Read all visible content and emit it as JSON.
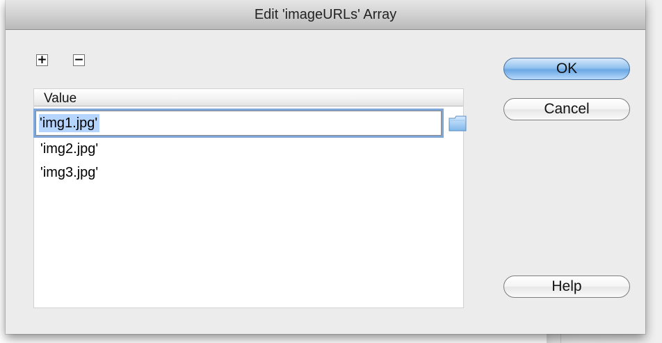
{
  "dialog": {
    "title": "Edit 'imageURLs' Array",
    "add_symbol": "+",
    "remove_symbol": "−"
  },
  "list": {
    "column_header": "Value",
    "items": [
      "'img1.jpg'",
      "'img2.jpg'",
      "'img3.jpg'"
    ],
    "selected_index": 0
  },
  "buttons": {
    "ok": "OK",
    "cancel": "Cancel",
    "help": "Help"
  },
  "colors": {
    "default_button": "#6aa7e4",
    "selection": "#b5d5ff",
    "focus_ring": "#7ea6d8"
  },
  "icons": {
    "add": "plus-icon",
    "remove": "minus-icon",
    "browse": "folder-icon"
  }
}
